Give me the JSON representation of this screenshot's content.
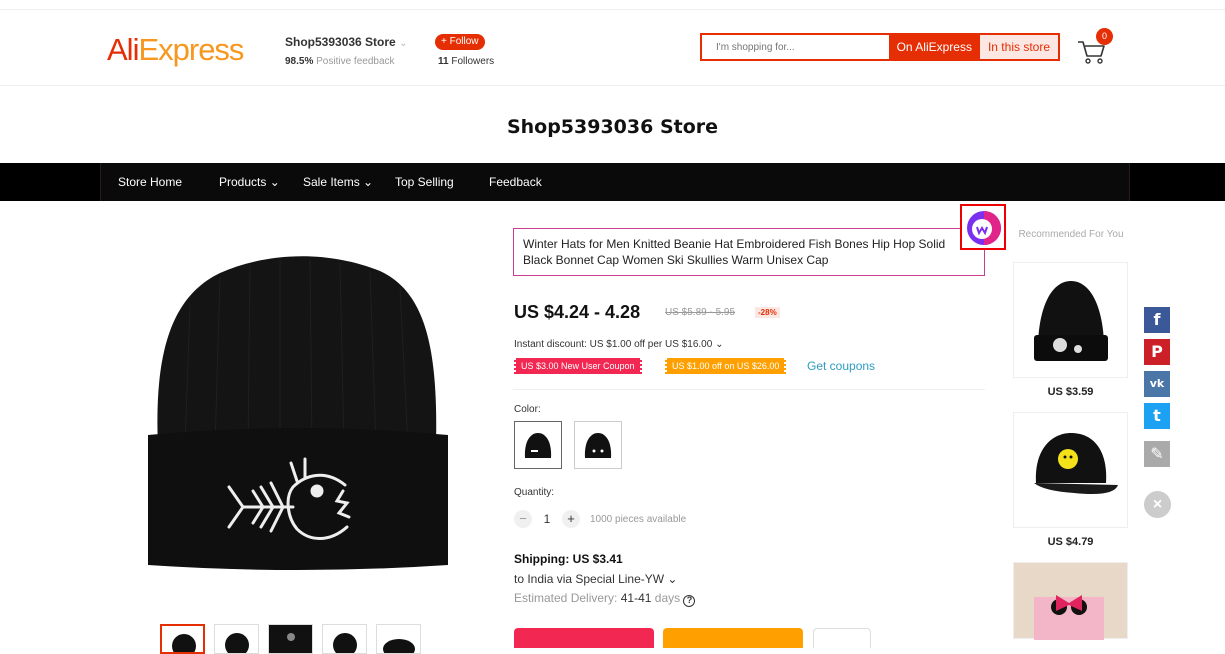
{
  "header": {
    "logo_ali": "Ali",
    "logo_express": "Express",
    "store_name": "Shop5393036 Store",
    "feedback_pct": "98.5%",
    "feedback_text": "Positive feedback",
    "follow_label": "+ Follow",
    "followers_count": "11",
    "followers_text": "Followers",
    "search_placeholder": "I'm shopping for...",
    "search_all_label": "On AliExpress",
    "search_store_label": "In this store",
    "cart_count": "0"
  },
  "banner": {
    "title": "Shop5393036 Store"
  },
  "nav": {
    "items": [
      "Store Home",
      "Products",
      "Sale Items",
      "Top Selling",
      "Feedback"
    ]
  },
  "product": {
    "title": "Winter Hats for Men Knitted Beanie Hat Embroidered Fish Bones Hip Hop Solid Black Bonnet Cap Women Ski Skullies Warm Unisex Cap",
    "price": "US $4.24 - 4.28",
    "old_price": "US $5.89 - 5.95",
    "discount": "-28%",
    "instant_discount": "Instant discount: US $1.00 off per US $16.00",
    "coupon_new_user": "US $3.00 New User Coupon",
    "coupon_store": "US $1.00 off on US $26.00",
    "get_coupons": "Get coupons",
    "color_label": "Color:",
    "quantity_label": "Quantity:",
    "quantity_value": "1",
    "quantity_minus": "−",
    "quantity_plus": "+",
    "available": "1000 pieces available",
    "shipping_title": "Shipping: US $3.41",
    "shipping_to": "to India via Special Line-YW",
    "estimated_label": "Estimated Delivery:",
    "estimated_value": "41-41",
    "estimated_unit": "days"
  },
  "recommended": {
    "title": "Recommended For You",
    "items": [
      {
        "price": "US $3.59"
      },
      {
        "price": "US $4.79"
      }
    ]
  },
  "share": {
    "facebook": "f",
    "pinterest": "P",
    "vk": "vk",
    "twitter": "t",
    "edit": "✎",
    "close": "×"
  },
  "colors": {
    "brand": "#e62e04",
    "brand_orange": "#f7971e",
    "coupon_pink": "#f22853",
    "coupon_orange": "#ffa000",
    "link_blue": "#2e9cc3",
    "facebook": "#3b5998",
    "pinterest": "#cb2027",
    "vk": "#4a76a8",
    "twitter": "#1da1f2",
    "edit": "#aaaaaa"
  }
}
